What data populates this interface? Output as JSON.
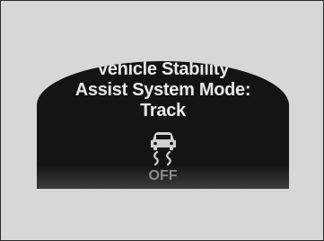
{
  "display": {
    "message_line1": "Vehicle Stability",
    "message_line2": "Assist System Mode:",
    "message_line3": "Track",
    "indicator_icon": "vsa-skid-icon",
    "indicator_label": "OFF",
    "colors": {
      "background": "#d7d7d7",
      "screen": "#141414",
      "text": "#e9e9e9",
      "off_label": "#8a8a8a"
    }
  }
}
